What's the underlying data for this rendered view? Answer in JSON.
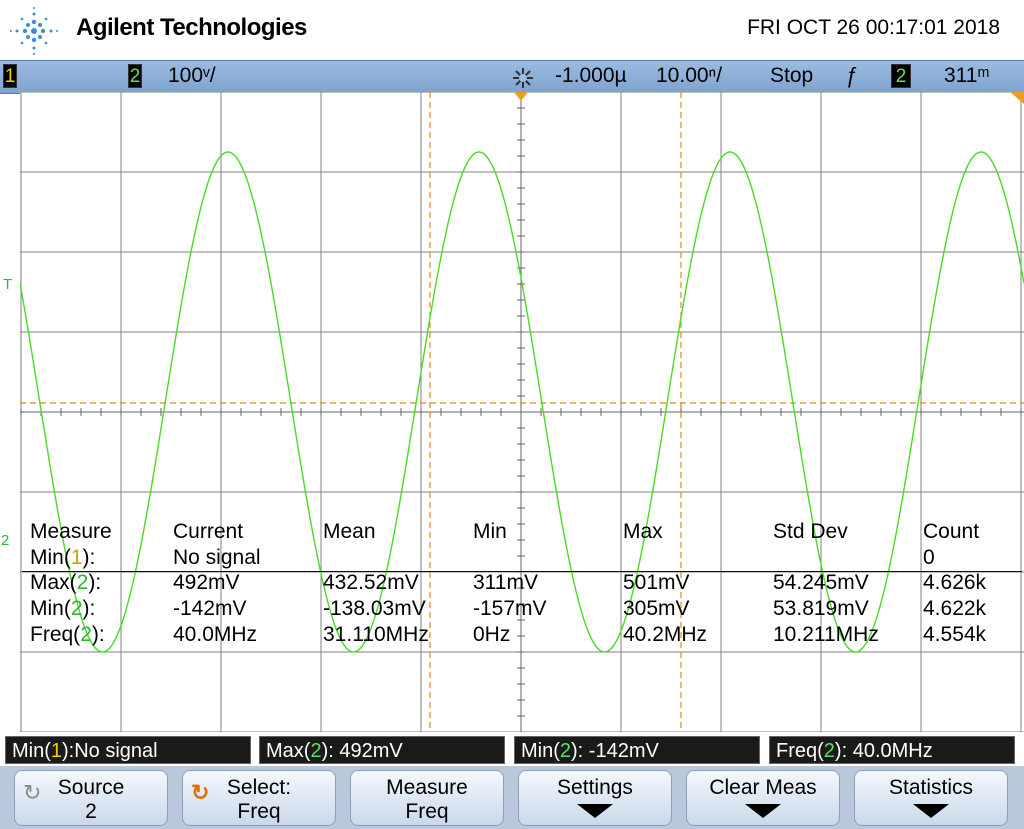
{
  "header": {
    "brand": "Agilent Technologies",
    "datetime": "FRI OCT 26 00:17:01 2018"
  },
  "status": {
    "ch1": "1",
    "ch2": "2",
    "ch2_scale": "100ᵛ/",
    "delay": "-1.000µ",
    "timebase": "10.00ⁿ/",
    "mode": "Stop",
    "trig_source": "2",
    "trig_level": "311ᵐ"
  },
  "markers": {
    "trigger_marker": "T",
    "ch2_ground_marker": "2"
  },
  "measurements": {
    "headers": [
      "Measure",
      "Current",
      "Mean",
      "Min",
      "Max",
      "Std Dev",
      "Count"
    ],
    "rows": [
      {
        "name_a": "Min(",
        "src": "1",
        "name_b": "):",
        "src_color": "yellow",
        "cells": [
          "No signal",
          "",
          "",
          "",
          "",
          "0"
        ]
      },
      {
        "name_a": "Max(",
        "src": "2",
        "name_b": "):",
        "src_color": "green",
        "cells": [
          "492mV",
          "432.52mV",
          "311mV",
          "501mV",
          "54.245mV",
          "4.626k"
        ]
      },
      {
        "name_a": "Min(",
        "src": "2",
        "name_b": "):",
        "src_color": "green",
        "cells": [
          "-142mV",
          "-138.03mV",
          "-157mV",
          "305mV",
          "53.819mV",
          "4.622k"
        ]
      },
      {
        "name_a": "Freq(",
        "src": "2",
        "name_b": "):",
        "src_color": "green",
        "cells": [
          "40.0MHz",
          "31.110MHz",
          "0Hz",
          "40.2MHz",
          "10.211MHz",
          "4.554k"
        ]
      }
    ]
  },
  "strips": [
    {
      "pre": "Min(",
      "src": "1",
      "post": "):No signal",
      "color": "yellow"
    },
    {
      "pre": "Max(",
      "src": "2",
      "post": "): 492mV",
      "color": "green"
    },
    {
      "pre": "Min(",
      "src": "2",
      "post": "): -142mV",
      "color": "green"
    },
    {
      "pre": "Freq(",
      "src": "2",
      "post": "): 40.0MHz",
      "color": "green"
    }
  ],
  "softkeys": [
    {
      "line1": "Source",
      "line2": "2",
      "icon": "rotate-knob-icon-grey"
    },
    {
      "line1": "Select:",
      "line2": "Freq",
      "icon": "rotate-knob-icon-orange"
    },
    {
      "line1": "Measure",
      "line2": "Freq",
      "icon": ""
    },
    {
      "line1": "Settings",
      "line2": "",
      "icon": "submenu-arrow-icon"
    },
    {
      "line1": "Clear Meas",
      "line2": "",
      "icon": "submenu-arrow-icon"
    },
    {
      "line1": "Statistics",
      "line2": "",
      "icon": "submenu-arrow-icon"
    }
  ],
  "colors": {
    "trace": "#44dd22",
    "grid": "#888888",
    "cursor": "#e08a1e",
    "ch1": "#f2d000",
    "ch2": "#5fe05f"
  }
}
